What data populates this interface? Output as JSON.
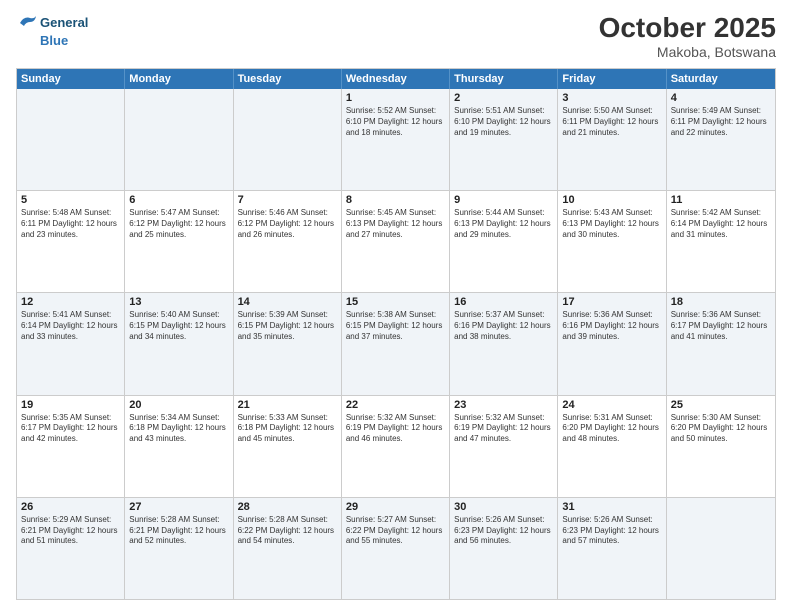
{
  "header": {
    "logo_line1": "General",
    "logo_line2": "Blue",
    "month": "October 2025",
    "location": "Makoba, Botswana"
  },
  "weekdays": [
    "Sunday",
    "Monday",
    "Tuesday",
    "Wednesday",
    "Thursday",
    "Friday",
    "Saturday"
  ],
  "rows": [
    [
      {
        "day": "",
        "text": ""
      },
      {
        "day": "",
        "text": ""
      },
      {
        "day": "",
        "text": ""
      },
      {
        "day": "1",
        "text": "Sunrise: 5:52 AM\nSunset: 6:10 PM\nDaylight: 12 hours\nand 18 minutes."
      },
      {
        "day": "2",
        "text": "Sunrise: 5:51 AM\nSunset: 6:10 PM\nDaylight: 12 hours\nand 19 minutes."
      },
      {
        "day": "3",
        "text": "Sunrise: 5:50 AM\nSunset: 6:11 PM\nDaylight: 12 hours\nand 21 minutes."
      },
      {
        "day": "4",
        "text": "Sunrise: 5:49 AM\nSunset: 6:11 PM\nDaylight: 12 hours\nand 22 minutes."
      }
    ],
    [
      {
        "day": "5",
        "text": "Sunrise: 5:48 AM\nSunset: 6:11 PM\nDaylight: 12 hours\nand 23 minutes."
      },
      {
        "day": "6",
        "text": "Sunrise: 5:47 AM\nSunset: 6:12 PM\nDaylight: 12 hours\nand 25 minutes."
      },
      {
        "day": "7",
        "text": "Sunrise: 5:46 AM\nSunset: 6:12 PM\nDaylight: 12 hours\nand 26 minutes."
      },
      {
        "day": "8",
        "text": "Sunrise: 5:45 AM\nSunset: 6:13 PM\nDaylight: 12 hours\nand 27 minutes."
      },
      {
        "day": "9",
        "text": "Sunrise: 5:44 AM\nSunset: 6:13 PM\nDaylight: 12 hours\nand 29 minutes."
      },
      {
        "day": "10",
        "text": "Sunrise: 5:43 AM\nSunset: 6:13 PM\nDaylight: 12 hours\nand 30 minutes."
      },
      {
        "day": "11",
        "text": "Sunrise: 5:42 AM\nSunset: 6:14 PM\nDaylight: 12 hours\nand 31 minutes."
      }
    ],
    [
      {
        "day": "12",
        "text": "Sunrise: 5:41 AM\nSunset: 6:14 PM\nDaylight: 12 hours\nand 33 minutes."
      },
      {
        "day": "13",
        "text": "Sunrise: 5:40 AM\nSunset: 6:15 PM\nDaylight: 12 hours\nand 34 minutes."
      },
      {
        "day": "14",
        "text": "Sunrise: 5:39 AM\nSunset: 6:15 PM\nDaylight: 12 hours\nand 35 minutes."
      },
      {
        "day": "15",
        "text": "Sunrise: 5:38 AM\nSunset: 6:15 PM\nDaylight: 12 hours\nand 37 minutes."
      },
      {
        "day": "16",
        "text": "Sunrise: 5:37 AM\nSunset: 6:16 PM\nDaylight: 12 hours\nand 38 minutes."
      },
      {
        "day": "17",
        "text": "Sunrise: 5:36 AM\nSunset: 6:16 PM\nDaylight: 12 hours\nand 39 minutes."
      },
      {
        "day": "18",
        "text": "Sunrise: 5:36 AM\nSunset: 6:17 PM\nDaylight: 12 hours\nand 41 minutes."
      }
    ],
    [
      {
        "day": "19",
        "text": "Sunrise: 5:35 AM\nSunset: 6:17 PM\nDaylight: 12 hours\nand 42 minutes."
      },
      {
        "day": "20",
        "text": "Sunrise: 5:34 AM\nSunset: 6:18 PM\nDaylight: 12 hours\nand 43 minutes."
      },
      {
        "day": "21",
        "text": "Sunrise: 5:33 AM\nSunset: 6:18 PM\nDaylight: 12 hours\nand 45 minutes."
      },
      {
        "day": "22",
        "text": "Sunrise: 5:32 AM\nSunset: 6:19 PM\nDaylight: 12 hours\nand 46 minutes."
      },
      {
        "day": "23",
        "text": "Sunrise: 5:32 AM\nSunset: 6:19 PM\nDaylight: 12 hours\nand 47 minutes."
      },
      {
        "day": "24",
        "text": "Sunrise: 5:31 AM\nSunset: 6:20 PM\nDaylight: 12 hours\nand 48 minutes."
      },
      {
        "day": "25",
        "text": "Sunrise: 5:30 AM\nSunset: 6:20 PM\nDaylight: 12 hours\nand 50 minutes."
      }
    ],
    [
      {
        "day": "26",
        "text": "Sunrise: 5:29 AM\nSunset: 6:21 PM\nDaylight: 12 hours\nand 51 minutes."
      },
      {
        "day": "27",
        "text": "Sunrise: 5:28 AM\nSunset: 6:21 PM\nDaylight: 12 hours\nand 52 minutes."
      },
      {
        "day": "28",
        "text": "Sunrise: 5:28 AM\nSunset: 6:22 PM\nDaylight: 12 hours\nand 54 minutes."
      },
      {
        "day": "29",
        "text": "Sunrise: 5:27 AM\nSunset: 6:22 PM\nDaylight: 12 hours\nand 55 minutes."
      },
      {
        "day": "30",
        "text": "Sunrise: 5:26 AM\nSunset: 6:23 PM\nDaylight: 12 hours\nand 56 minutes."
      },
      {
        "day": "31",
        "text": "Sunrise: 5:26 AM\nSunset: 6:23 PM\nDaylight: 12 hours\nand 57 minutes."
      },
      {
        "day": "",
        "text": ""
      }
    ]
  ],
  "alt_rows": [
    0,
    2,
    4
  ]
}
